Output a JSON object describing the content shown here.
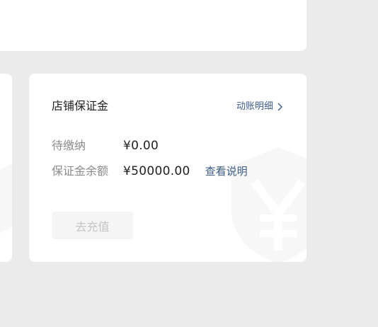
{
  "deposit_card": {
    "title": "店铺保证金",
    "detail_link": "动账明细",
    "pending": {
      "label": "待缴纳",
      "value": "¥0.00"
    },
    "balance": {
      "label": "保证金余额",
      "value": "¥50000.00",
      "explain_link": "查看说明"
    },
    "recharge_button": "去充值",
    "watermark_icon": "yen-shield-icon"
  },
  "colors": {
    "page_background": "#ebebeb",
    "card_background": "#ffffff",
    "link": "#3a5a8a",
    "label": "#8c8c8c",
    "text": "#1f1f1f",
    "disabled_button_bg": "#f5f5f5",
    "disabled_button_text": "#c4c4c4"
  }
}
